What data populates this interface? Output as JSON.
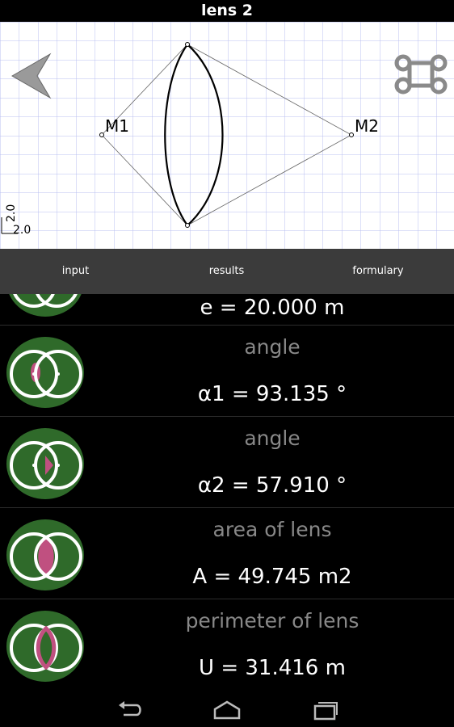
{
  "window": {
    "title": "lens 2"
  },
  "canvas": {
    "point_m1": "M1",
    "point_m2": "M2",
    "scale_v": "2.0",
    "scale_h": "2.0"
  },
  "tabs": [
    {
      "label": "input"
    },
    {
      "label": "results"
    },
    {
      "label": "formulary"
    }
  ],
  "results": [
    {
      "label": "",
      "value": "e = 20.000 m"
    },
    {
      "label": "angle",
      "value": "α1 = 93.135 °"
    },
    {
      "label": "angle",
      "value": "α2 = 57.910 °"
    },
    {
      "label": "area of lens",
      "value": "A = 49.745 m2"
    },
    {
      "label": "perimeter of lens",
      "value": "U = 31.416 m"
    }
  ],
  "colors": {
    "grid": "#b9bff0",
    "accent": "#c05080",
    "thumb_bg": "#2f6a2a"
  }
}
